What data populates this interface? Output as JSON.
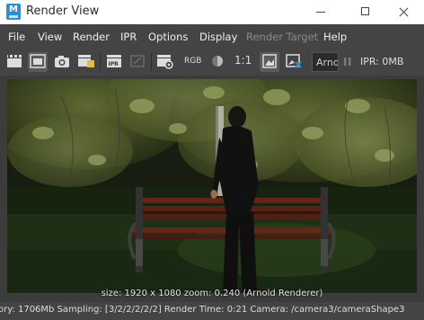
{
  "window": {
    "title": "Render View",
    "app_icon_letter": "M"
  },
  "menu": [
    {
      "label": "File",
      "enabled": true
    },
    {
      "label": "View",
      "enabled": true
    },
    {
      "label": "Render",
      "enabled": true
    },
    {
      "label": "IPR",
      "enabled": true
    },
    {
      "label": "Options",
      "enabled": true
    },
    {
      "label": "Display",
      "enabled": true
    },
    {
      "label": "Render Target",
      "enabled": false
    },
    {
      "label": "Help",
      "enabled": true
    }
  ],
  "toolbar": {
    "rgb_label": "RGB",
    "ratio_label": "1:1",
    "renderer_value": "Arnold",
    "ipr_memory": "IPR: 0MB",
    "icons": [
      "render-frame-icon",
      "render-region-icon",
      "snapshot-icon",
      "keep-image-icon",
      "ipr-render-icon",
      "refresh-ipr-icon",
      "render-settings-icon",
      "display-channel-icon",
      "ratio-icon",
      "frame-image-icon",
      "remove-image-icon",
      "pause-icon"
    ]
  },
  "render": {
    "info": "size: 1920 x 1080 zoom: 0.240      (Arnold Renderer)"
  },
  "status": {
    "text": "ory: 1706Mb    Sampling: [3/2/2/2/2/2]    Render Time: 0:21    Camera: /camera3/cameraShape3"
  },
  "colors": {
    "title_bg": "#ffffff",
    "ui_bg": "#444444",
    "app_icon": "#2d8fd2"
  }
}
